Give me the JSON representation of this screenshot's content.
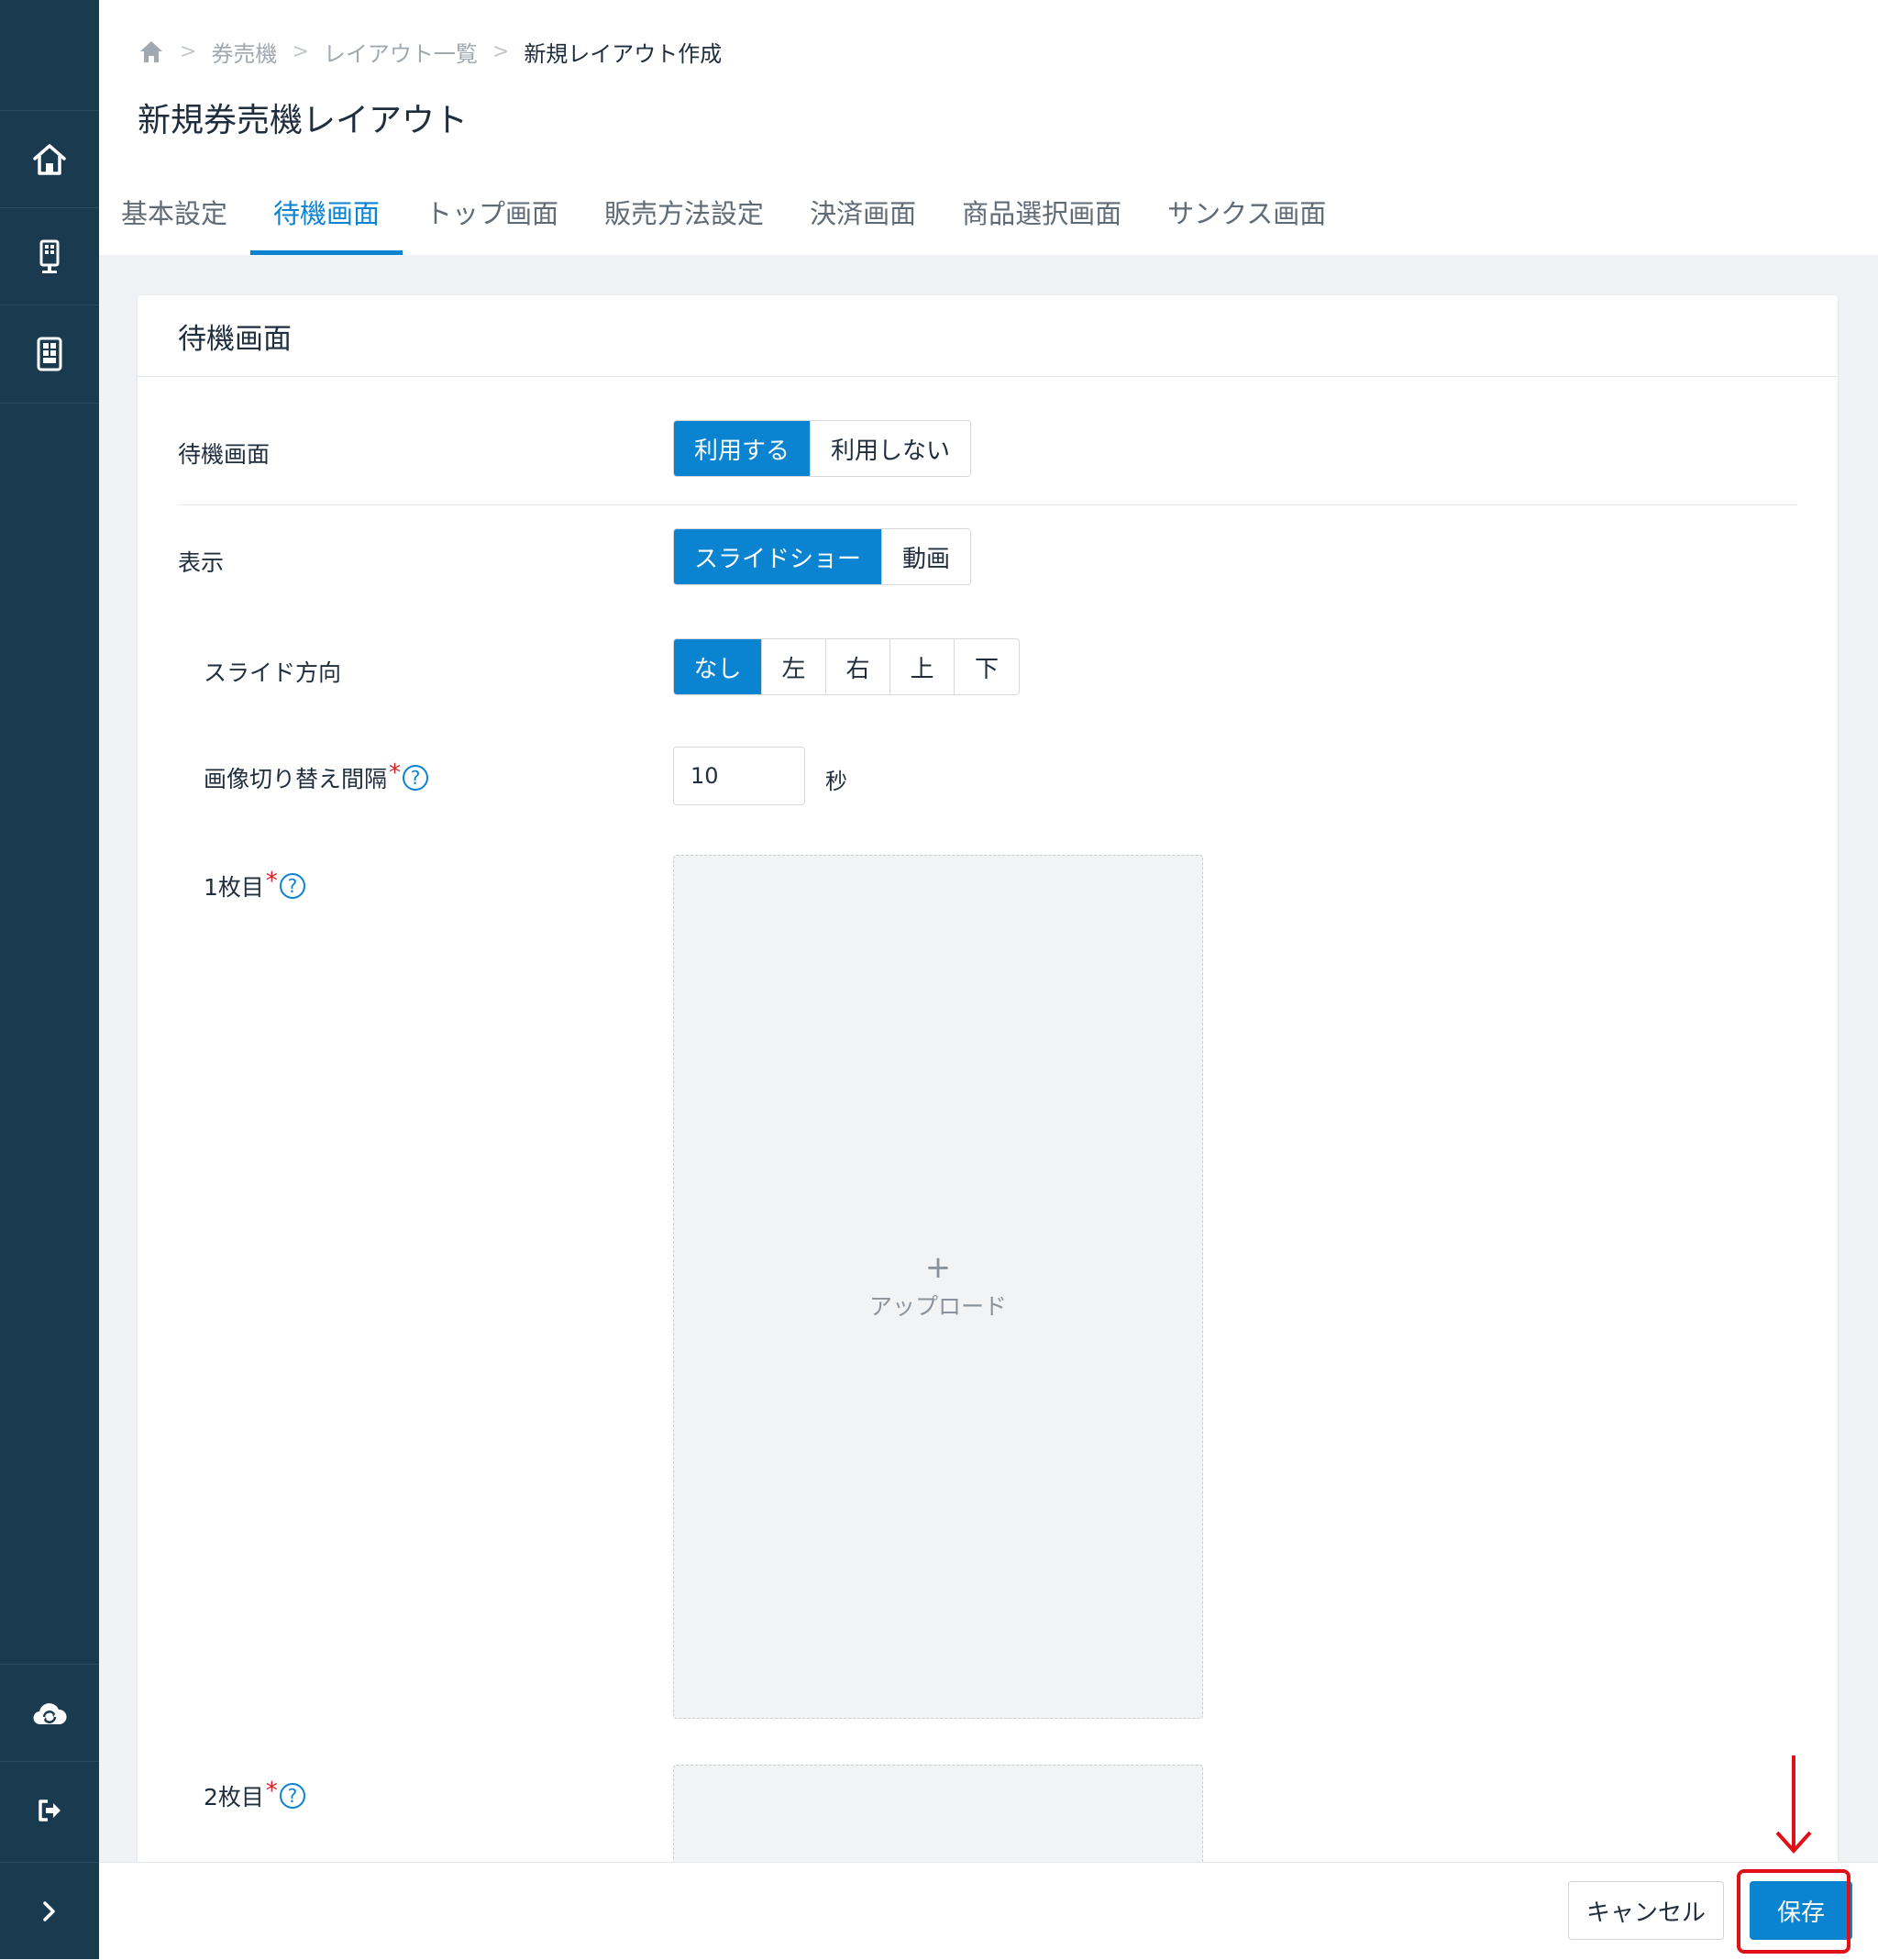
{
  "breadcrumb": {
    "home_icon": "home-icon",
    "items": [
      "券売機",
      "レイアウト一覧",
      "新規レイアウト作成"
    ]
  },
  "page": {
    "title": "新規券売機レイアウト"
  },
  "tabs": [
    {
      "label": "基本設定",
      "active": false
    },
    {
      "label": "待機画面",
      "active": true
    },
    {
      "label": "トップ画面",
      "active": false
    },
    {
      "label": "販売方法設定",
      "active": false
    },
    {
      "label": "決済画面",
      "active": false
    },
    {
      "label": "商品選択画面",
      "active": false
    },
    {
      "label": "サンクス画面",
      "active": false
    }
  ],
  "sidebar": {
    "icons": [
      "home-icon",
      "kiosk-icon",
      "tablet-icon",
      "cloud-sync-icon",
      "logout-icon",
      "expand-icon"
    ]
  },
  "card": {
    "title": "待機画面",
    "standby": {
      "label": "待機画面",
      "options": [
        "利用する",
        "利用しない"
      ],
      "selected": "利用する"
    },
    "display": {
      "label": "表示",
      "options": [
        "スライドショー",
        "動画"
      ],
      "selected": "スライドショー"
    },
    "slide_direction": {
      "label": "スライド方向",
      "options": [
        "なし",
        "左",
        "右",
        "上",
        "下"
      ],
      "selected": "なし"
    },
    "interval": {
      "label": "画像切り替え間隔",
      "required_mark": "*",
      "help": "?",
      "value": "10",
      "unit": "秒"
    },
    "image1": {
      "label": "1枚目",
      "required_mark": "*",
      "help": "?",
      "upload_plus": "+",
      "upload_text": "アップロード"
    },
    "image2": {
      "label": "2枚目",
      "required_mark": "*",
      "help": "?"
    }
  },
  "footer": {
    "cancel_label": "キャンセル",
    "save_label": "保存"
  },
  "colors": {
    "sidebar_bg": "#1a3a50",
    "accent": "#0a83d1",
    "annotation_red": "#e0101a"
  }
}
